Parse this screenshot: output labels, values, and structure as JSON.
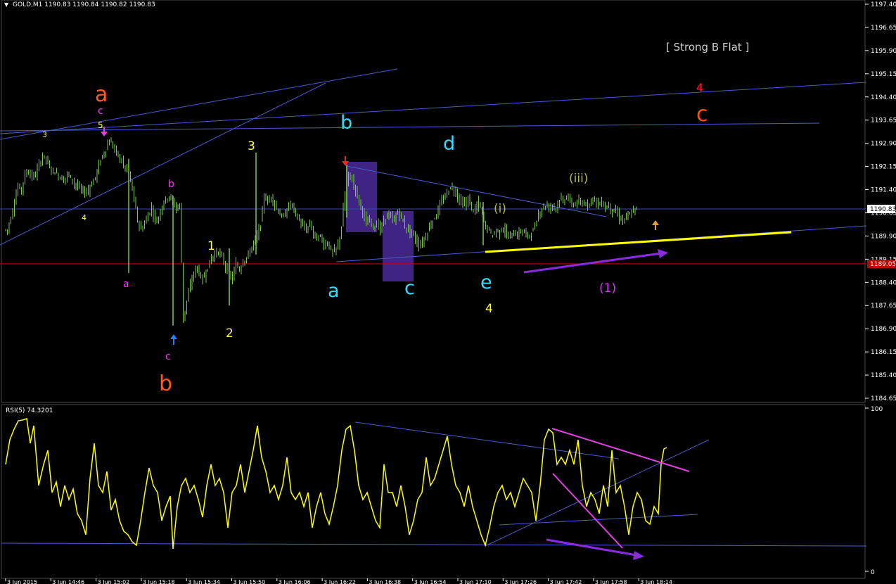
{
  "header": {
    "title": "GOLD,M1  1190.83 1190.84 1190.82 1190.83"
  },
  "rsi_header": {
    "title": "RSI(5) 74.3201"
  },
  "colors": {
    "background": "#000000",
    "candle": "#7ec850",
    "grid": "#2a2a2a",
    "trendline": "#4a5bd1",
    "rsi_line": "#ffff00",
    "magenta_line": "#e040e0",
    "purple_arrow": "#8a2be2",
    "price_badge": "#c00000",
    "current_price_badge": "#ffffff"
  },
  "price_panel": {
    "y_ticks": [
      "1197.40",
      "1196.65",
      "1195.90",
      "1195.15",
      "1194.40",
      "1193.65",
      "1192.90",
      "1192.15",
      "1191.40",
      "1190.65",
      "1189.90",
      "1189.15",
      "1188.40",
      "1187.65",
      "1186.90",
      "1186.15",
      "1185.40",
      "1184.65"
    ],
    "current_price": "1190.83",
    "red_level": "1189.05"
  },
  "rsi_panel": {
    "y_ticks": [
      "100",
      "0"
    ]
  },
  "x_ticks": [
    "3 Jun 2015",
    "3 Jun 14:46",
    "3 Jun 15:02",
    "3 Jun 15:18",
    "3 Jun 15:34",
    "3 Jun 15:50",
    "3 Jun 16:06",
    "3 Jun 16:22",
    "3 Jun 16:38",
    "3 Jun 16:54",
    "3 Jun 17:10",
    "3 Jun 17:26",
    "3 Jun 17:42",
    "3 Jun 17:58",
    "3 Jun 18:14"
  ],
  "annotations": {
    "strong_b_flat": "[ Strong B Flat ]",
    "a_big_orange": "a",
    "b_big_orange": "b",
    "c_big_orange": "c",
    "four_red": "4",
    "c_mag_top": "c",
    "five_yel": "5",
    "three_yel_left": "3",
    "four_yel_left": "4",
    "a_mag": "a",
    "b_mag": "b",
    "c_mag": "c",
    "one_yel": "1",
    "two_yel": "2",
    "three_yel": "3",
    "four_yel_bottom": "4",
    "a_cyan": "a",
    "b_cyan": "b",
    "c_cyan": "c",
    "d_cyan": "d",
    "e_cyan": "e",
    "i_olive": "(i)",
    "iii_olive": "(iii)",
    "one_mag": "(1)"
  },
  "chart_data": {
    "type": "candlestick",
    "title": "GOLD,M1",
    "ylim": [
      1184.65,
      1197.4
    ],
    "price_x_anchors": [
      0,
      5,
      10,
      15,
      20,
      25,
      30,
      35,
      40,
      45,
      50,
      55,
      60,
      65,
      70,
      75,
      80,
      85,
      90,
      95,
      100,
      105,
      110,
      115,
      120,
      125,
      130,
      135,
      140,
      145,
      150,
      155,
      160,
      165,
      170,
      175,
      180,
      185,
      190,
      195,
      200,
      205,
      210,
      215,
      220,
      225,
      230,
      235,
      240,
      245,
      250,
      255,
      260,
      265,
      270,
      275,
      280,
      285,
      290,
      295,
      300,
      305,
      310,
      315,
      320,
      325,
      330,
      335,
      340,
      345,
      350,
      355,
      360,
      365,
      370,
      375,
      380,
      385,
      390,
      395,
      400,
      405,
      410,
      415,
      420,
      425,
      430,
      435,
      440,
      445,
      450,
      455,
      460,
      465,
      470,
      475,
      480,
      485,
      490,
      495,
      500,
      505,
      510,
      515,
      520,
      525,
      530,
      535,
      540,
      545,
      550,
      555,
      560,
      565,
      570,
      575,
      580,
      585,
      590,
      595,
      600,
      605,
      610,
      615,
      620,
      625,
      630,
      635,
      640,
      645,
      650,
      655,
      660,
      665,
      670,
      675,
      680,
      685,
      690,
      695,
      700,
      705,
      710,
      715,
      720,
      725,
      730,
      735,
      740,
      745,
      750,
      755,
      760,
      765,
      770,
      775,
      780,
      785,
      790,
      795,
      800,
      805,
      810,
      815,
      820,
      825,
      830,
      835,
      840,
      845,
      850,
      855,
      860,
      865,
      870,
      875,
      880,
      885,
      890,
      895,
      900,
      905,
      910,
      915,
      920,
      925,
      930,
      935,
      940,
      945
    ],
    "close_approx": [
      1190.1,
      1190.5,
      1191.0,
      1191.5,
      1191.4,
      1191.9,
      1192.0,
      1191.8,
      1191.9,
      1192.2,
      1192.5,
      1192.4,
      1192.1,
      1192.0,
      1191.9,
      1191.8,
      1191.7,
      1191.9,
      1191.8,
      1191.6,
      1191.5,
      1191.4,
      1191.3,
      1191.4,
      1191.6,
      1191.8,
      1192.2,
      1192.5,
      1192.7,
      1193.0,
      1192.8,
      1192.6,
      1192.4,
      1192.2,
      1192.0,
      1191.7,
      1191.1,
      1190.4,
      1190.1,
      1190.3,
      1190.6,
      1190.8,
      1190.4,
      1190.5,
      1190.9,
      1191.1,
      1191.2,
      1191.0,
      1190.8,
      1190.9,
      1187.2,
      1187.8,
      1188.3,
      1188.7,
      1188.9,
      1188.5,
      1188.6,
      1188.9,
      1189.2,
      1189.3,
      1189.4,
      1189.2,
      1188.9,
      1188.7,
      1188.5,
      1189.0,
      1188.8,
      1189.1,
      1189.2,
      1189.4,
      1189.7,
      1189.9,
      1190.3,
      1191.2,
      1191.0,
      1191.2,
      1190.9,
      1190.7,
      1190.5,
      1190.6,
      1190.9,
      1190.9,
      1190.6,
      1190.4,
      1190.2,
      1190.1,
      1190.3,
      1190.0,
      1189.8,
      1189.9,
      1189.6,
      1189.7,
      1189.4,
      1189.4,
      1189.6,
      1190.2,
      1191.3,
      1191.9,
      1191.7,
      1191.4,
      1191.0,
      1190.7,
      1190.3,
      1190.4,
      1190.2,
      1190.3,
      1190.1,
      1190.4,
      1190.6,
      1190.5,
      1190.4,
      1190.7,
      1190.5,
      1190.2,
      1190.1,
      1190.0,
      1189.8,
      1189.6,
      1189.7,
      1189.9,
      1190.2,
      1190.4,
      1190.6,
      1190.9,
      1191.1,
      1191.3,
      1191.5,
      1191.4,
      1191.2,
      1191.0,
      1190.9,
      1191.1,
      1190.8,
      1190.7,
      1191.0,
      1190.6,
      1190.2,
      1190.1,
      1189.9,
      1190.1,
      1190.0,
      1190.2,
      1189.9,
      1189.9,
      1190.0,
      1189.9,
      1190.1,
      1190.0,
      1189.9,
      1190.0,
      1190.2,
      1190.6,
      1190.8,
      1190.9,
      1190.8,
      1190.9,
      1190.8,
      1191.1,
      1191.0,
      1191.2,
      1191.0,
      1190.9,
      1191.0,
      1190.9,
      1191.0,
      1190.9,
      1191.1,
      1191.1,
      1190.9,
      1191.0,
      1190.8,
      1190.9,
      1190.7,
      1190.7,
      1190.5,
      1190.4,
      1190.5,
      1190.6,
      1190.7,
      1190.8
    ]
  }
}
